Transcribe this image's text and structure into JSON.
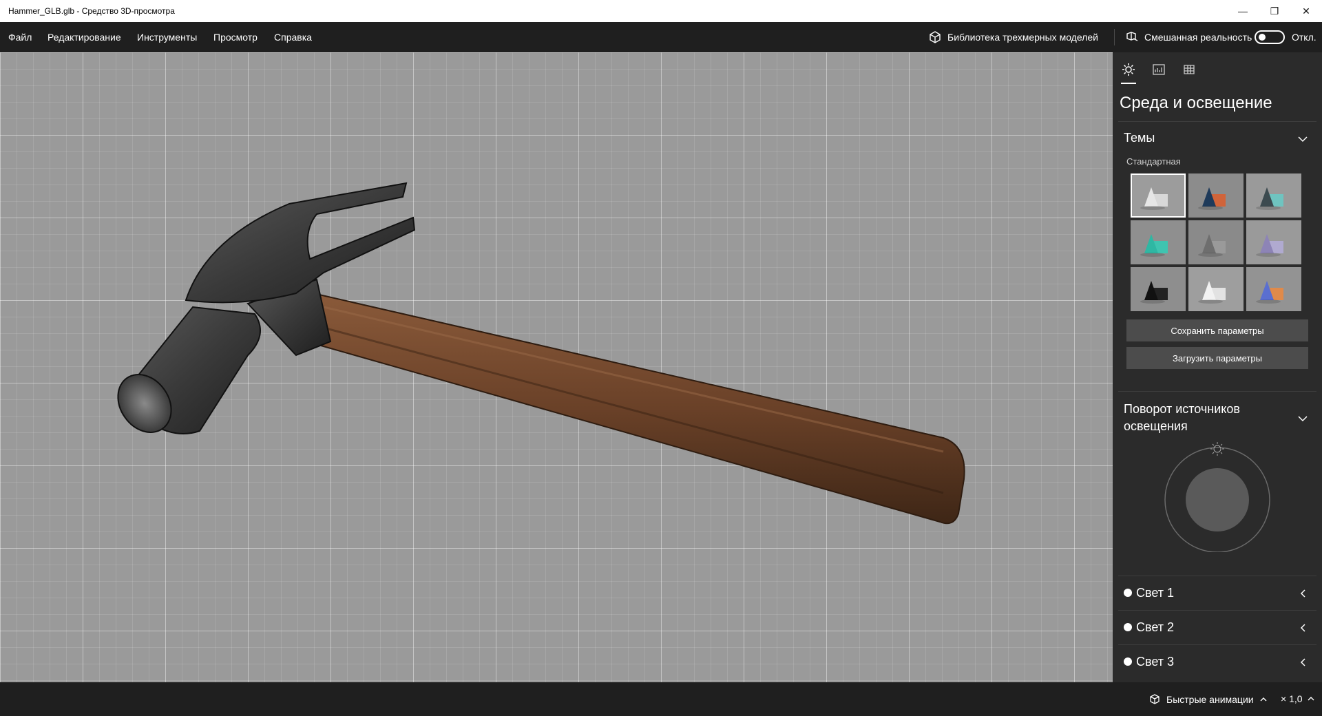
{
  "window": {
    "title": "Hammer_GLB.glb - Средство 3D-просмотра",
    "minimize_glyph": "—",
    "maximize_glyph": "❐",
    "close_glyph": "✕"
  },
  "menu": {
    "items": [
      "Файл",
      "Редактирование",
      "Инструменты",
      "Просмотр",
      "Справка"
    ],
    "library_label": "Библиотека трехмерных моделей",
    "mixed_reality_label": "Смешанная реальность",
    "toggle_state": "Откл."
  },
  "panel": {
    "title": "Среда и освещение",
    "themes": {
      "header": "Темы",
      "group_label": "Стандартная",
      "thumbnails": [
        {
          "name": "theme-1",
          "bg": "#9c9c9c",
          "obj": "#e6e6e6",
          "obj2": "#d8d8d8"
        },
        {
          "name": "theme-2",
          "bg": "#8c8c8c",
          "obj": "#1e3a5a",
          "obj2": "#d0643a"
        },
        {
          "name": "theme-3",
          "bg": "#9a9a9a",
          "obj": "#3c4a4f",
          "obj2": "#6fc4c0"
        },
        {
          "name": "theme-4",
          "bg": "#8f8f8f",
          "obj": "#2fb7a3",
          "obj2": "#3fc4b0"
        },
        {
          "name": "theme-5",
          "bg": "#8a8a8a",
          "obj": "#6e6e6e",
          "obj2": "#9a9a9a"
        },
        {
          "name": "theme-6",
          "bg": "#9a9a9a",
          "obj": "#8d84b6",
          "obj2": "#b0aad0"
        },
        {
          "name": "theme-7",
          "bg": "#8e8e8e",
          "obj": "#111111",
          "obj2": "#222222"
        },
        {
          "name": "theme-8",
          "bg": "#9e9e9e",
          "obj": "#f2f2f2",
          "obj2": "#e2e2e2"
        },
        {
          "name": "theme-9",
          "bg": "#939393",
          "obj": "#5a6fd0",
          "obj2": "#e08a4a"
        }
      ],
      "save_label": "Сохранить параметры",
      "load_label": "Загрузить параметры"
    },
    "rotation": {
      "header": "Поворот источников освещения"
    },
    "lights": [
      "Свет 1",
      "Свет 2",
      "Свет 3"
    ]
  },
  "bottom": {
    "animations_label": "Быстрые анимации",
    "speed_label": "× 1,0"
  }
}
